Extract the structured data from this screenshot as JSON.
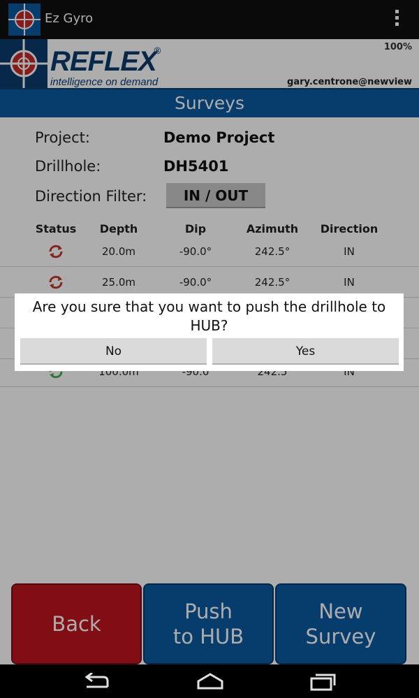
{
  "actionbar": {
    "title": "Ez Gyro"
  },
  "banner": {
    "brand": "REFLEX",
    "registered": "®",
    "tagline": "intelligence on demand",
    "battery": "100%",
    "user": "gary.centrone@newview"
  },
  "screen_title": "Surveys",
  "details": {
    "project_label": "Project:",
    "project_value": "Demo Project",
    "drillhole_label": "Drillhole:",
    "drillhole_value": "DH5401",
    "filter_label": "Direction Filter:",
    "filter_value": "IN / OUT"
  },
  "table": {
    "headers": [
      "Status",
      "Depth",
      "Dip",
      "Azimuth",
      "Direction"
    ],
    "rows": [
      {
        "status": "sync-pending-icon",
        "depth": "20.0m",
        "dip": "-90.0°",
        "azimuth": "242.5°",
        "direction": "IN"
      },
      {
        "status": "sync-pending-icon",
        "depth": "25.0m",
        "dip": "-90.0°",
        "azimuth": "242.5°",
        "direction": "IN"
      },
      {
        "status": "sync-done-icon",
        "depth": "100.0m",
        "dip": "-90.0",
        "azimuth": "242.5",
        "direction": "IN"
      }
    ]
  },
  "dialog": {
    "message": "Are you sure that you want to push the drillhole to HUB?",
    "no_label": "No",
    "yes_label": "Yes"
  },
  "buttons": {
    "back": "Back",
    "push": "Push\nto HUB",
    "new": "New\nSurvey"
  },
  "colors": {
    "accent": "#0b5aa1",
    "brand": "#0d3c6e",
    "back": "#c01620",
    "status_pending": "#c0392b",
    "status_done": "#4caf50"
  }
}
